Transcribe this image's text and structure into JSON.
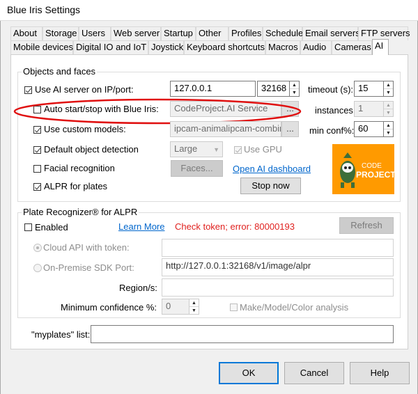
{
  "window": {
    "title": "Blue Iris Settings"
  },
  "tabs": {
    "row1": [
      "About",
      "Storage",
      "Users",
      "Web server",
      "Startup",
      "Other",
      "Profiles",
      "Schedule",
      "Email servers",
      "FTP servers"
    ],
    "row2": [
      "Mobile devices",
      "Digital IO and IoT",
      "Joystick",
      "Keyboard shortcuts",
      "Macros",
      "Audio",
      "Cameras",
      "AI"
    ],
    "active": "AI"
  },
  "objects": {
    "group_title": "Objects and faces",
    "use_ai_server_label": "Use AI server on IP/port:",
    "use_ai_server_checked": true,
    "ip_value": "127.0.0.1",
    "port_value": "32168",
    "timeout_label": "timeout (s):",
    "timeout_value": "15",
    "auto_start_label": "Auto start/stop with Blue Iris:",
    "auto_start_checked": false,
    "service_value": "CodeProject.AI Service",
    "ellipsis_label": "...",
    "instances_label": "instances:",
    "instances_value": "1",
    "custom_models_label": "Use custom models:",
    "custom_models_checked": true,
    "custom_models_value": "ipcam-animalipcam-combir",
    "min_conf_label": "min conf%:",
    "min_conf_value": "60",
    "default_detection_label": "Default object detection",
    "default_detection_checked": true,
    "size_value": "Large",
    "use_gpu_label": "Use GPU",
    "use_gpu_checked": true,
    "facial_label": "Facial recognition",
    "facial_checked": false,
    "faces_button": "Faces...",
    "dashboard_link": "Open AI dashboard",
    "alpr_label": "ALPR for plates",
    "alpr_checked": true,
    "stop_button": "Stop now",
    "logo_text_1": "CODE",
    "logo_text_2": "PROJECT"
  },
  "plate": {
    "group_title": "Plate Recognizer® for ALPR",
    "enabled_label": "Enabled",
    "enabled_checked": false,
    "learn_more": "Learn More",
    "error_text": "Check token; error: 80000193",
    "refresh_button": "Refresh",
    "cloud_api_label": "Cloud API with token:",
    "cloud_api_value": "",
    "on_premise_label": "On-Premise SDK Port:",
    "on_premise_value": "http://127.0.0.1:32168/v1/image/alpr",
    "region_label": "Region/s:",
    "region_value": "",
    "min_conf_label": "Minimum confidence %:",
    "min_conf_value": "0",
    "make_model_label": "Make/Model/Color analysis",
    "make_model_checked": false
  },
  "myplates": {
    "label": "\"myplates\" list:",
    "value": ""
  },
  "footer": {
    "ok": "OK",
    "cancel": "Cancel",
    "help": "Help"
  },
  "colors": {
    "accent": "#0078d7",
    "link": "#0066cc",
    "error": "#e0211f",
    "annotation": "#e01010",
    "logo_bg": "#ff9a00"
  }
}
